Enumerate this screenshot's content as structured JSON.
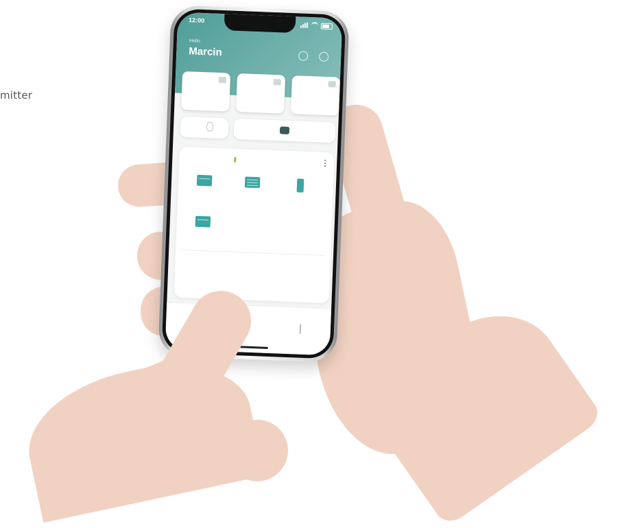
{
  "page": {
    "side_caption_fragment": "mitter"
  },
  "phone": {
    "status": {
      "time": "12:00"
    },
    "header": {
      "greeting": "Hello",
      "user_name": "Marcin",
      "icons": [
        "settings-icon",
        "notification-icon"
      ]
    },
    "cards": [
      {
        "icon": "device-thumbnail-icon"
      },
      {
        "icon": "device-thumbnail-icon"
      },
      {
        "icon": "device-thumbnail-icon"
      }
    ],
    "quick_row": {
      "bulb_icon": "lightbulb-icon",
      "mode_icon": "mode-toggle-icon"
    },
    "room": {
      "accent_color": "#8bc34a",
      "devices": [
        {
          "icon": "window-sensor-icon"
        },
        {
          "icon": "blind-icon"
        },
        {
          "icon": "door-sensor-icon"
        },
        {
          "icon": "window-sensor-icon"
        }
      ]
    },
    "bottom_nav": {
      "items": [
        {
          "icon": "home-icon"
        },
        {
          "icon": "menu-icon"
        }
      ]
    },
    "colors": {
      "header_teal": "#4f9d98",
      "device_teal": "#3ba6a2"
    }
  }
}
